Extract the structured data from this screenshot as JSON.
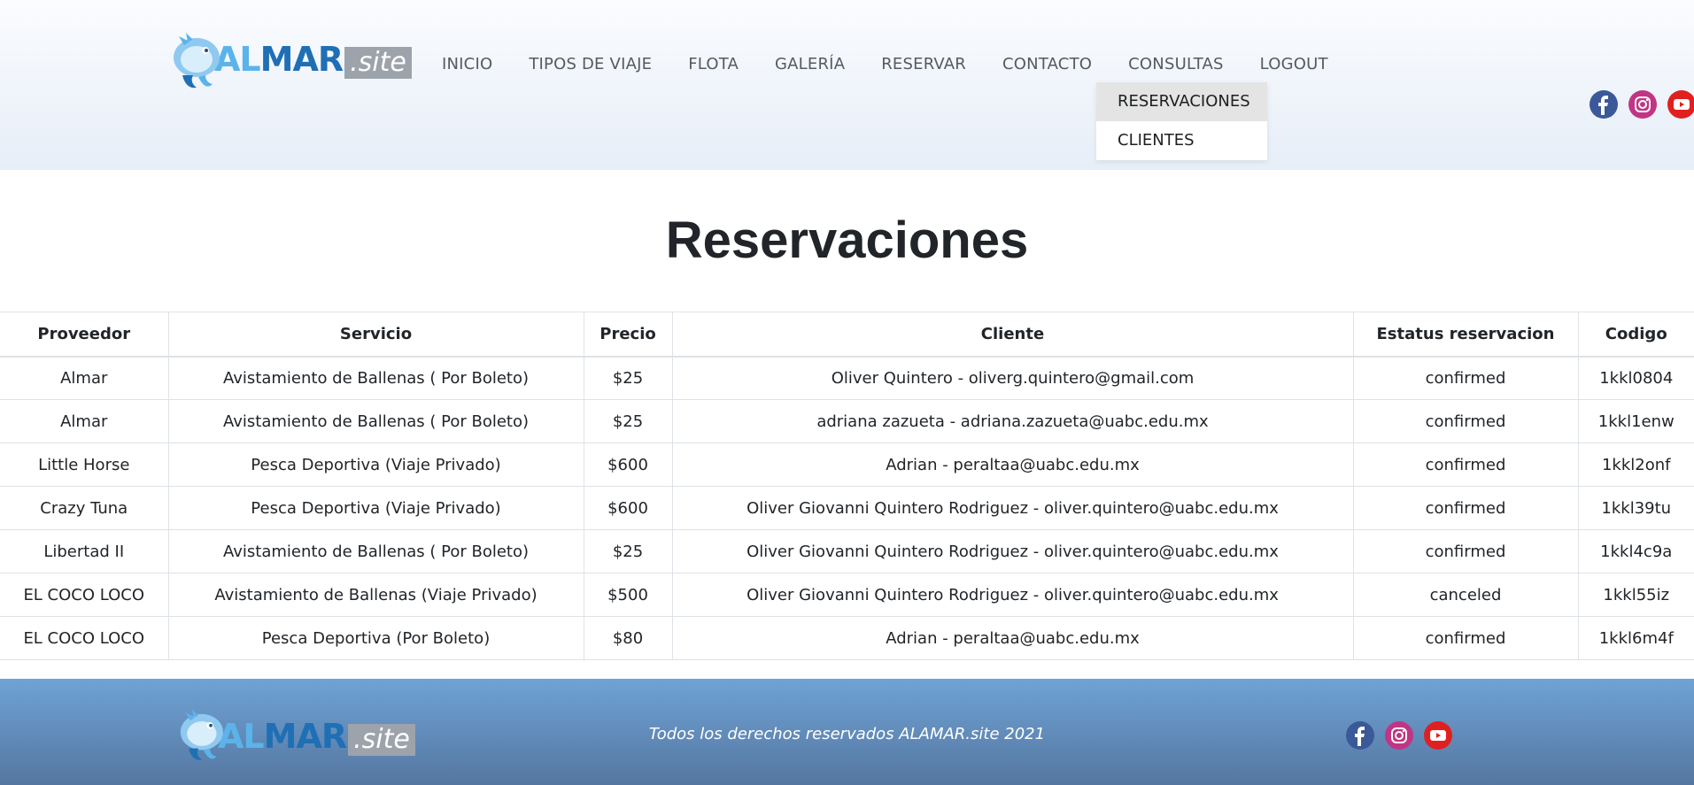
{
  "brand": {
    "al": "AL",
    "mar": "MAR",
    "site": ".site"
  },
  "nav": {
    "items": [
      "INICIO",
      "TIPOS DE VIAJE",
      "FLOTA",
      "GALERÍA",
      "RESERVAR",
      "CONTACTO",
      "CONSULTAS",
      "LOGOUT"
    ],
    "dropdown": [
      "RESERVACIONES",
      "CLIENTES"
    ]
  },
  "page": {
    "title": "Reservaciones"
  },
  "table": {
    "headers": [
      "Proveedor",
      "Servicio",
      "Precio",
      "Cliente",
      "Estatus reservacion",
      "Codigo"
    ],
    "rows": [
      [
        "Almar",
        "Avistamiento de Ballenas ( Por Boleto)",
        "$25",
        "Oliver Quintero - oliverg.quintero@gmail.com",
        "confirmed",
        "1kkl0804"
      ],
      [
        "Almar",
        "Avistamiento de Ballenas ( Por Boleto)",
        "$25",
        "adriana zazueta - adriana.zazueta@uabc.edu.mx",
        "confirmed",
        "1kkl1enw"
      ],
      [
        "Little Horse",
        "Pesca Deportiva (Viaje Privado)",
        "$600",
        "Adrian - peraltaa@uabc.edu.mx",
        "confirmed",
        "1kkl2onf"
      ],
      [
        "Crazy Tuna",
        "Pesca Deportiva (Viaje Privado)",
        "$600",
        "Oliver Giovanni Quintero Rodriguez - oliver.quintero@uabc.edu.mx",
        "confirmed",
        "1kkl39tu"
      ],
      [
        "Libertad II",
        "Avistamiento de Ballenas ( Por Boleto)",
        "$25",
        "Oliver Giovanni Quintero Rodriguez - oliver.quintero@uabc.edu.mx",
        "confirmed",
        "1kkl4c9a"
      ],
      [
        "EL COCO LOCO",
        "Avistamiento de Ballenas (Viaje Privado)",
        "$500",
        "Oliver Giovanni Quintero Rodriguez - oliver.quintero@uabc.edu.mx",
        "canceled",
        "1kkl55iz"
      ],
      [
        "EL COCO LOCO",
        "Pesca Deportiva (Por Boleto)",
        "$80",
        "Adrian - peraltaa@uabc.edu.mx",
        "confirmed",
        "1kkl6m4f"
      ]
    ]
  },
  "footer": {
    "text": "Todos los derechos reservados ALAMAR.site 2021"
  },
  "icons": {
    "social": [
      "facebook-icon",
      "instagram-icon",
      "youtube-icon"
    ]
  },
  "colors": {
    "facebook": "#3b5998",
    "instagram": "#c13584",
    "youtube": "#e02020",
    "accent": "#1f6fb5"
  }
}
